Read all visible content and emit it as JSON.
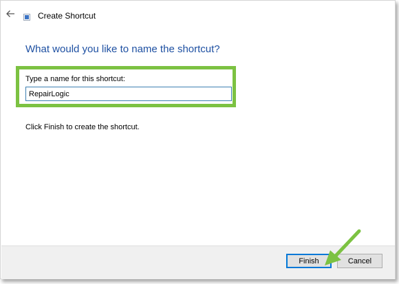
{
  "window": {
    "title": "Create Shortcut",
    "back_icon": "back-arrow-icon",
    "app_icon": "shortcut-icon"
  },
  "main": {
    "heading": "What would you like to name the shortcut?",
    "name_field": {
      "label": "Type a name for this shortcut:",
      "value": "RepairLogic"
    },
    "hint": "Click Finish to create the shortcut."
  },
  "footer": {
    "finish_label": "Finish",
    "cancel_label": "Cancel"
  },
  "annotations": {
    "highlight_color": "#7cc242",
    "arrow_color": "#7cc242"
  },
  "colors": {
    "heading": "#1e50a2",
    "input_border": "#3c7fb1",
    "default_button_border": "#0078d7"
  }
}
